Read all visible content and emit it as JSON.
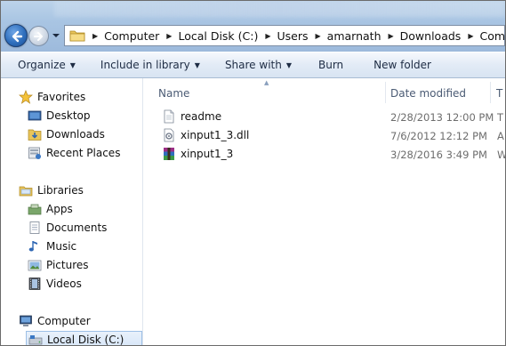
{
  "address_bar": {
    "breadcrumbs": [
      "Computer",
      "Local Disk (C:)",
      "Users",
      "amarnath",
      "Downloads",
      "Compressed"
    ]
  },
  "toolbar": {
    "organize": "Organize",
    "include_in_library": "Include in library",
    "share_with": "Share with",
    "burn": "Burn",
    "new_folder": "New folder"
  },
  "nav_pane": {
    "favorites": {
      "label": "Favorites",
      "items": [
        "Desktop",
        "Downloads",
        "Recent Places"
      ]
    },
    "libraries": {
      "label": "Libraries",
      "items": [
        "Apps",
        "Documents",
        "Music",
        "Pictures",
        "Videos"
      ]
    },
    "computer": {
      "label": "Computer",
      "items": [
        "Local Disk (C:)"
      ]
    }
  },
  "file_list": {
    "columns": {
      "name": "Name",
      "date_modified": "Date modified",
      "type": "T"
    },
    "files": [
      {
        "name": "readme",
        "date": "2/28/2013 12:00 PM",
        "type": "T",
        "icon": "text-document-icon"
      },
      {
        "name": "xinput1_3.dll",
        "date": "7/6/2012 12:12 PM",
        "type": "A",
        "icon": "dll-file-icon"
      },
      {
        "name": "xinput1_3",
        "date": "3/28/2016 3:49 PM",
        "type": "W",
        "icon": "winrar-archive-icon"
      }
    ]
  },
  "colors": {
    "accent": "#2f6fbd",
    "command_bar_text": "#1e2c44",
    "column_header_text": "#4b5b74",
    "secondary_text": "#6d6d6d"
  }
}
